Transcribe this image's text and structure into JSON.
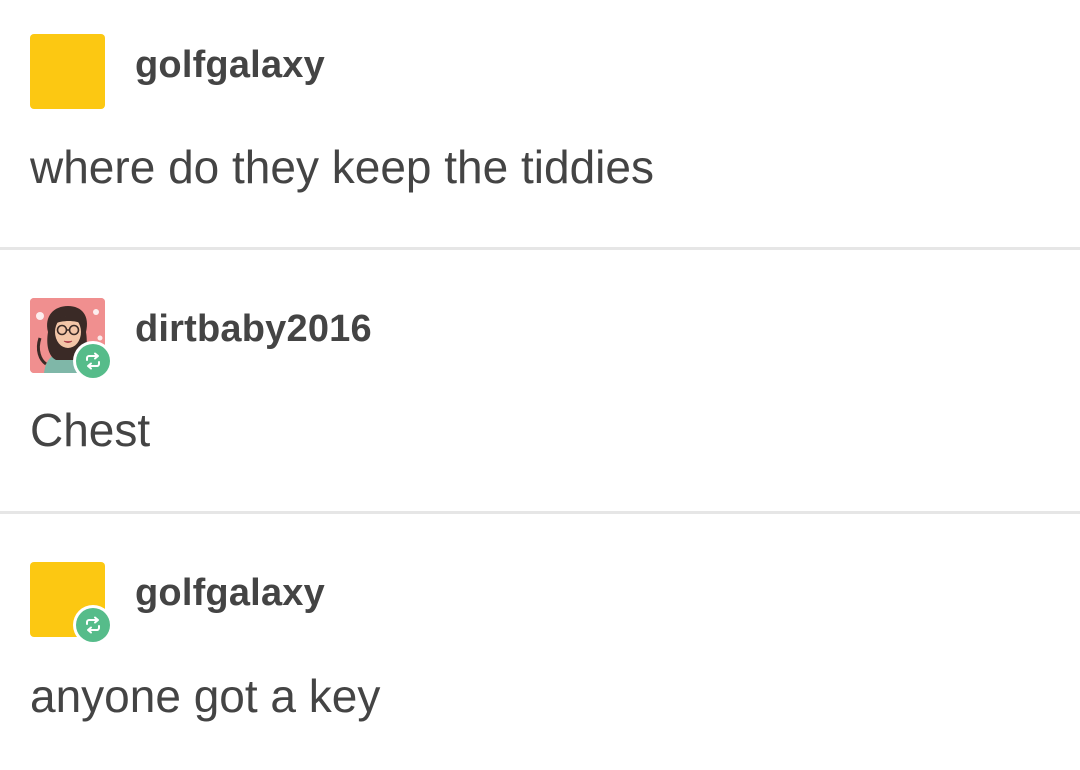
{
  "thread": {
    "posts": [
      {
        "username": "golfgalaxy",
        "avatar": "yellow-square-avatar",
        "reblog": false,
        "text": "where do they keep the tiddies"
      },
      {
        "username": "dirtbaby2016",
        "avatar": "illustrated-girl-avatar",
        "reblog": true,
        "text": "Chest"
      },
      {
        "username": "golfgalaxy",
        "avatar": "yellow-square-avatar",
        "reblog": true,
        "text": "anyone got a key"
      }
    ]
  },
  "colors": {
    "avatar_yellow": "#fcc812",
    "reblog_green": "#56bc8a",
    "text": "#444444",
    "divider": "#e6e6e6"
  },
  "icons": {
    "reblog": "reblog-icon"
  }
}
